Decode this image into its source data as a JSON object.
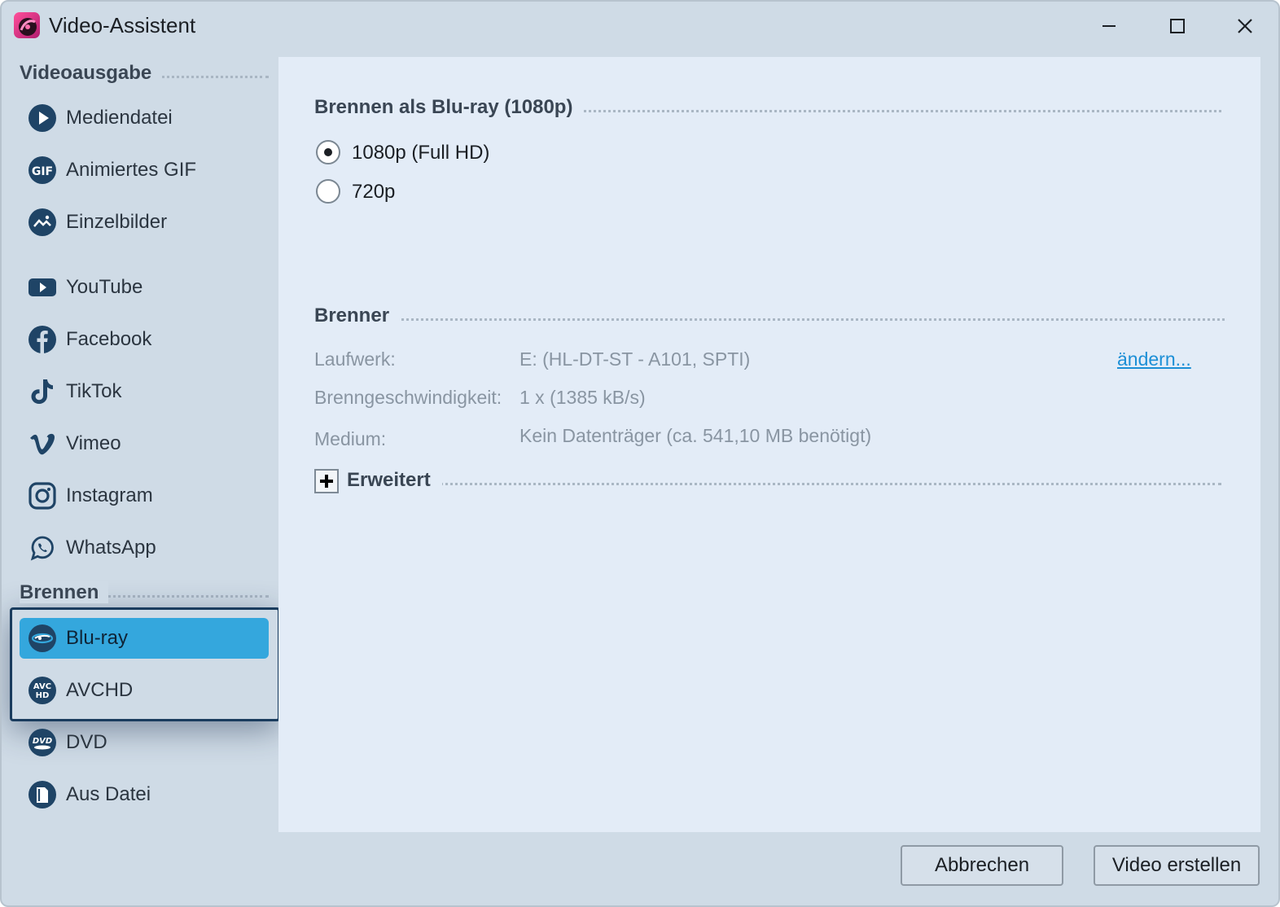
{
  "window": {
    "title": "Video-Assistent",
    "controls": {
      "minimize": "minimize-icon",
      "maximize": "maximize-icon",
      "close": "close-icon"
    }
  },
  "sidebar": {
    "sections": [
      {
        "heading": "Videoausgabe"
      },
      {
        "heading": "Brennen"
      }
    ],
    "items": [
      {
        "label": "Mediendatei",
        "icon": "play-circle-icon"
      },
      {
        "label": "Animiertes GIF",
        "icon": "gif-icon"
      },
      {
        "label": "Einzelbilder",
        "icon": "image-icon"
      },
      {
        "label": "YouTube",
        "icon": "youtube-icon"
      },
      {
        "label": "Facebook",
        "icon": "facebook-icon"
      },
      {
        "label": "TikTok",
        "icon": "tiktok-icon"
      },
      {
        "label": "Vimeo",
        "icon": "vimeo-icon"
      },
      {
        "label": "Instagram",
        "icon": "instagram-icon"
      },
      {
        "label": "WhatsApp",
        "icon": "whatsapp-icon"
      },
      {
        "label": "Blu-ray",
        "icon": "bluray-icon",
        "selected": true
      },
      {
        "label": "AVCHD",
        "icon": "avchd-icon"
      },
      {
        "label": "DVD",
        "icon": "dvd-icon"
      },
      {
        "label": "Aus Datei",
        "icon": "file-icon"
      }
    ]
  },
  "main": {
    "format_group": {
      "heading": "Brennen als Blu-ray (1080p)",
      "options": [
        {
          "label": "1080p (Full HD)",
          "selected": true
        },
        {
          "label": "720p",
          "selected": false
        }
      ]
    },
    "burner_group": {
      "heading": "Brenner",
      "drive_label": "Laufwerk:",
      "drive_value": "E: (HL-DT-ST - A101, SPTI)",
      "change_link": "ändern...",
      "speed_label": "Brenngeschwindigkeit:",
      "speed_value": "1 x (1385 kB/s)",
      "medium_label": "Medium:",
      "medium_value": "Kein Datenträger (ca. 541,10 MB benötigt)"
    },
    "advanced": {
      "heading": "Erweitert",
      "expanded": false
    }
  },
  "footer": {
    "cancel_label": "Abbrechen",
    "create_label": "Video erstellen"
  },
  "colors": {
    "accent": "#34a7dd",
    "icon": "#1f4466",
    "link": "#1c8fd6",
    "selection_border": "#1a3c5e"
  }
}
